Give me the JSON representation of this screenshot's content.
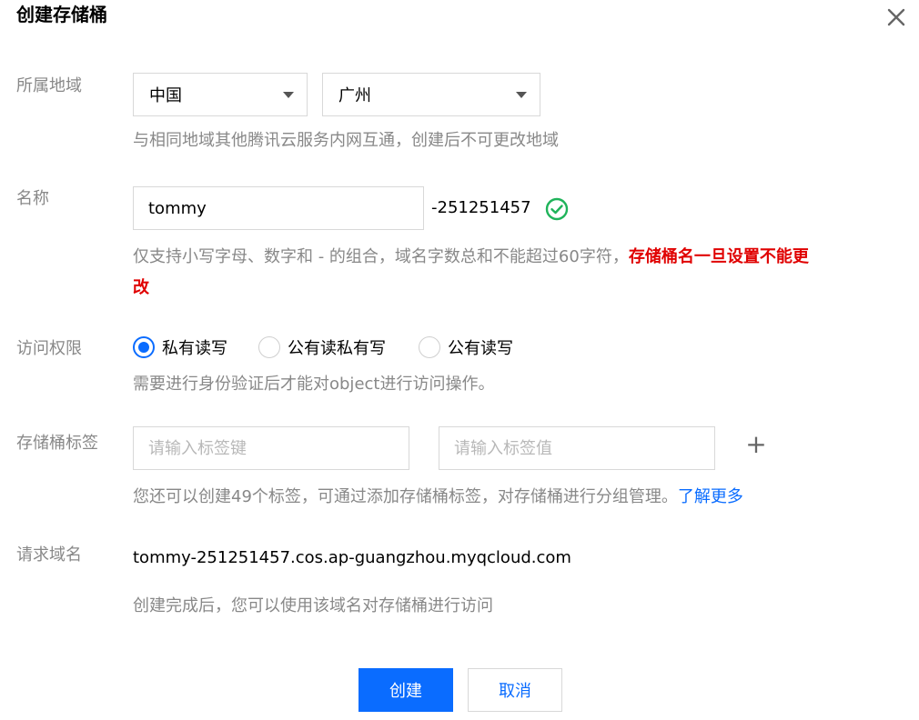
{
  "dialog": {
    "title": "创建存储桶"
  },
  "region": {
    "label": "所属地域",
    "country": "中国",
    "city": "广州",
    "hint": "与相同地域其他腾讯云服务内网互通，创建后不可更改地域"
  },
  "name": {
    "label": "名称",
    "value": "tommy",
    "suffix": "-251251457",
    "hint_line1": "仅支持小写字母、数字和 - 的组合，域名字数总和不能超过60字符，",
    "hint_warning_line1": "存储桶名一旦设置不能更",
    "hint_warning_line2": "改"
  },
  "access": {
    "label": "访问权限",
    "options": [
      "私有读写",
      "公有读私有写",
      "公有读写"
    ],
    "selected": "私有读写",
    "hint": "需要进行身份验证后才能对object进行访问操作。"
  },
  "tags": {
    "label": "存储桶标签",
    "key_placeholder": "请输入标签键",
    "value_placeholder": "请输入标签值",
    "add": "+",
    "hint": "您还可以创建49个标签，可通过添加存储桶标签，对存储桶进行分组管理。",
    "learn_more": "了解更多"
  },
  "domain": {
    "label": "请求域名",
    "value": "tommy-251251457.cos.ap-guangzhou.myqcloud.com",
    "hint": "创建完成后，您可以使用该域名对存储桶进行访问"
  },
  "footer": {
    "create": "创建",
    "cancel": "取消"
  },
  "colors": {
    "primary": "#0a6cff",
    "warning": "#e00000",
    "success": "#1fb35a"
  }
}
